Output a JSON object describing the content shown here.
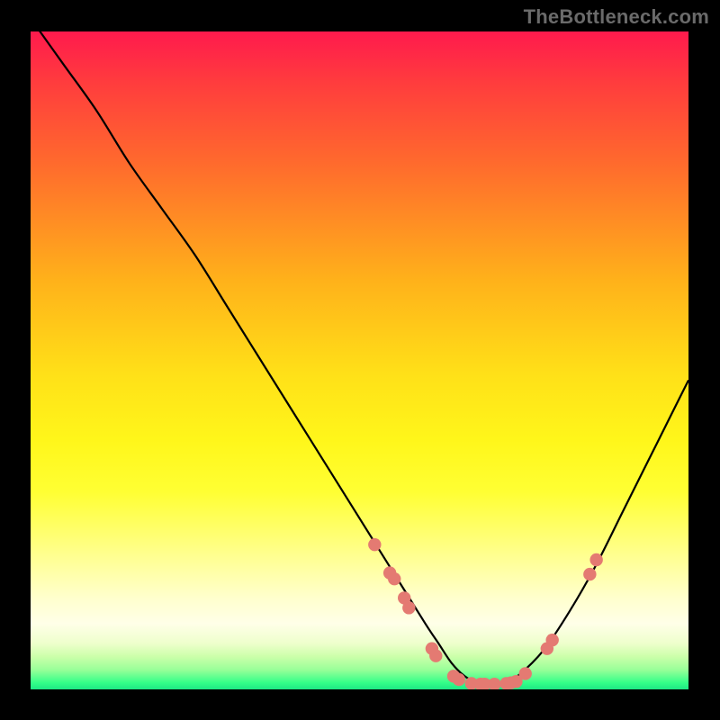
{
  "watermark": "TheBottleneck.com",
  "chart_data": {
    "type": "line",
    "title": "",
    "xlabel": "",
    "ylabel": "",
    "xlim": [
      0,
      100
    ],
    "ylim": [
      0,
      100
    ],
    "series": [
      {
        "name": "curve",
        "x": [
          0,
          5,
          10,
          15,
          20,
          25,
          30,
          35,
          40,
          45,
          50,
          55,
          60,
          62,
          64,
          66,
          68,
          70,
          72,
          74,
          78,
          82,
          86,
          90,
          94,
          98,
          100
        ],
        "y": [
          102,
          95,
          88,
          80,
          73,
          66,
          58,
          50,
          42,
          34,
          26,
          18,
          10,
          7,
          4,
          2,
          1,
          1,
          1,
          2,
          6,
          12,
          19,
          27,
          35,
          43,
          47
        ]
      }
    ],
    "markers": [
      {
        "x": 52.3,
        "y": 22.0
      },
      {
        "x": 54.6,
        "y": 17.7
      },
      {
        "x": 55.3,
        "y": 16.8
      },
      {
        "x": 56.8,
        "y": 13.9
      },
      {
        "x": 57.5,
        "y": 12.4
      },
      {
        "x": 61.0,
        "y": 6.2
      },
      {
        "x": 61.6,
        "y": 5.1
      },
      {
        "x": 64.3,
        "y": 2.0
      },
      {
        "x": 65.1,
        "y": 1.5
      },
      {
        "x": 67.0,
        "y": 0.9
      },
      {
        "x": 68.4,
        "y": 0.8
      },
      {
        "x": 69.0,
        "y": 0.8
      },
      {
        "x": 70.5,
        "y": 0.8
      },
      {
        "x": 72.3,
        "y": 0.9
      },
      {
        "x": 73.0,
        "y": 1.0
      },
      {
        "x": 73.8,
        "y": 1.2
      },
      {
        "x": 75.2,
        "y": 2.4
      },
      {
        "x": 78.5,
        "y": 6.2
      },
      {
        "x": 79.3,
        "y": 7.5
      },
      {
        "x": 85.0,
        "y": 17.5
      },
      {
        "x": 86.0,
        "y": 19.7
      }
    ],
    "marker_color": "#e47a72",
    "curve_color": "#000000"
  }
}
